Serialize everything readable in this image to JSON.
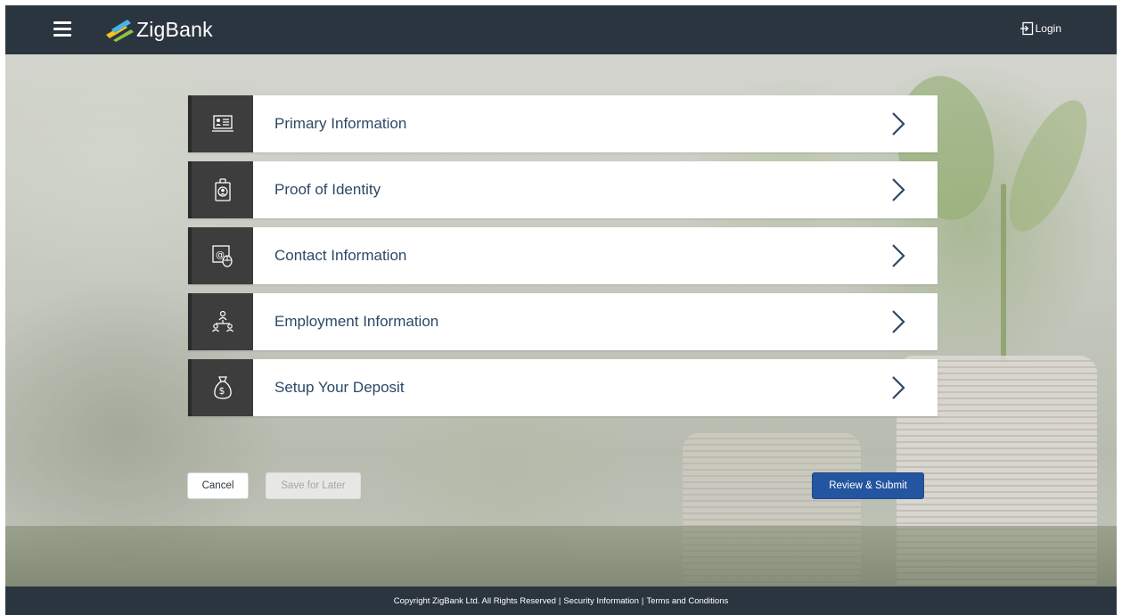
{
  "header": {
    "brand": "ZigBank",
    "login_label": "Login"
  },
  "sections": [
    {
      "title": "Primary Information",
      "icon": "id-card-icon"
    },
    {
      "title": "Proof of Identity",
      "icon": "id-badge-icon"
    },
    {
      "title": "Contact Information",
      "icon": "contact-mouse-icon"
    },
    {
      "title": "Employment Information",
      "icon": "org-chart-icon"
    },
    {
      "title": "Setup Your Deposit",
      "icon": "money-bag-icon"
    }
  ],
  "actions": {
    "cancel": "Cancel",
    "save_for_later": "Save for Later",
    "review_submit": "Review & Submit"
  },
  "footer": {
    "copyright": "Copyright ZigBank Ltd. All Rights Reserved",
    "separator": "|",
    "security": "Security Information",
    "terms": "Terms and Conditions"
  },
  "colors": {
    "header_bg": "#2b3540",
    "section_icon_bg": "#3d3d3d",
    "section_title": "#2c4866",
    "primary_button": "#2355a0"
  }
}
